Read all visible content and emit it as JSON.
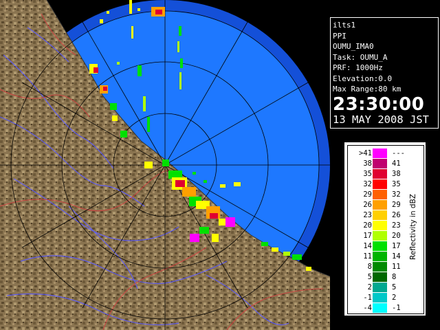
{
  "info_panel": {
    "station": "ilts1",
    "mode": "PPI",
    "site": "OUMU_IMA0",
    "task": "Task: OUMU_A",
    "prf": "PRF: 1000Hz",
    "elevation": "Elevation:0.0",
    "max_range": "Max Range:80 km",
    "time": "23:30:00",
    "date": "13 MAY 2008 JST"
  },
  "legend": {
    "title": "Reflectivity in dBZ",
    "rows": [
      {
        "lo": ">41",
        "hi": "---",
        "color": "#ff00ff"
      },
      {
        "lo": "38",
        "hi": "41",
        "color": "#c00070"
      },
      {
        "lo": "35",
        "hi": "38",
        "color": "#e00030"
      },
      {
        "lo": "32",
        "hi": "35",
        "color": "#ff0000"
      },
      {
        "lo": "29",
        "hi": "32",
        "color": "#ff6000"
      },
      {
        "lo": "26",
        "hi": "29",
        "color": "#ffa000"
      },
      {
        "lo": "23",
        "hi": "26",
        "color": "#ffd000"
      },
      {
        "lo": "20",
        "hi": "23",
        "color": "#ffff00"
      },
      {
        "lo": "17",
        "hi": "20",
        "color": "#b0ff00"
      },
      {
        "lo": "14",
        "hi": "17",
        "color": "#00e000"
      },
      {
        "lo": "11",
        "hi": "14",
        "color": "#00b400"
      },
      {
        "lo": "8",
        "hi": "11",
        "color": "#008a00"
      },
      {
        "lo": "5",
        "hi": "8",
        "color": "#006800"
      },
      {
        "lo": "2",
        "hi": "5",
        "color": "#00a890"
      },
      {
        "lo": "-1",
        "hi": "2",
        "color": "#00c8c8"
      },
      {
        "lo": "-4",
        "hi": "-1",
        "color": "#00ffff"
      }
    ]
  },
  "map_colors": {
    "sea": "#1e78ff",
    "sea_outer": "#1450d8",
    "land": "#8a7450",
    "rivers": "#5a5aff",
    "borders": "#d04040",
    "range_rings": "#000000"
  }
}
